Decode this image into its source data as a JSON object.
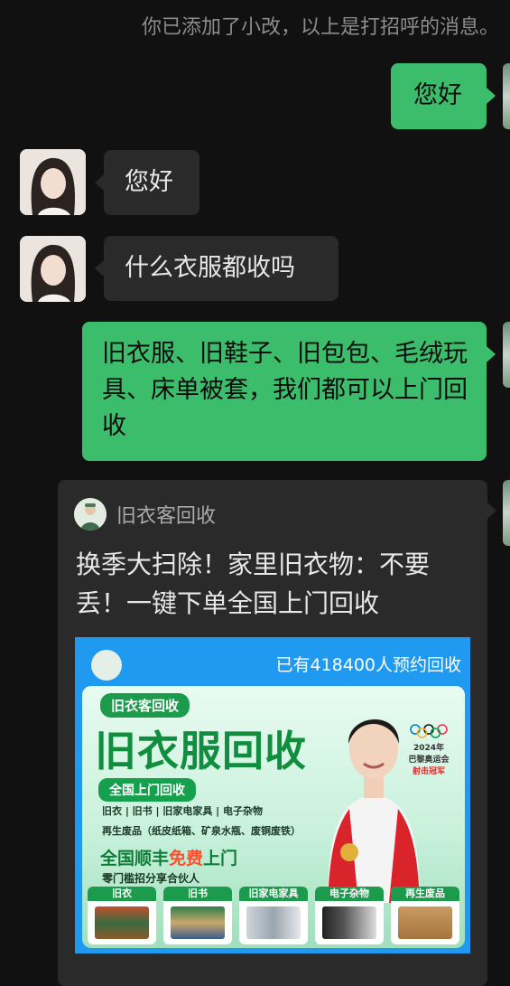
{
  "system_message": "你已添加了小改，以上是打招呼的消息。",
  "messages": [
    {
      "side": "right",
      "text": "您好"
    },
    {
      "side": "left",
      "text": "您好"
    },
    {
      "side": "left",
      "text": "什么衣服都收吗"
    },
    {
      "side": "right",
      "text": "旧衣服、旧鞋子、旧包包、毛绒玩具、床单被套，我们都可以上门回收"
    }
  ],
  "shared_card": {
    "source_name": "旧衣客回收",
    "title": "换季大扫除！家里旧衣物：不要丢！一键下单全国上门回收",
    "poster": {
      "reservation_count": "已有418400人预约回收",
      "brand_tag": "旧衣客回收",
      "headline": "旧衣服回收",
      "service_tag": "全国上门回收",
      "categories_line": "旧衣 | 旧书 | 旧家电家具 | 电子杂物",
      "recycle_line": "再生废品（纸皮纸箱、矿泉水瓶、废铜废铁）",
      "shipping_pre": "全国顺丰",
      "shipping_free": "免费",
      "shipping_post": "上门",
      "partner_line": "零门槛招分享合伙人",
      "olympic_year": "2024年",
      "olympic_event": "巴黎奥运会",
      "olympic_title": "射击冠军",
      "category_tiles": [
        "旧衣",
        "旧书",
        "旧家电家具",
        "电子杂物",
        "再生废品"
      ]
    }
  },
  "colors": {
    "background": "#111111",
    "bubble_self": "#3cbd6b",
    "bubble_other": "#2a2a2a",
    "poster_blue": "#1f9af0",
    "brand_green": "#0f8f3e"
  }
}
